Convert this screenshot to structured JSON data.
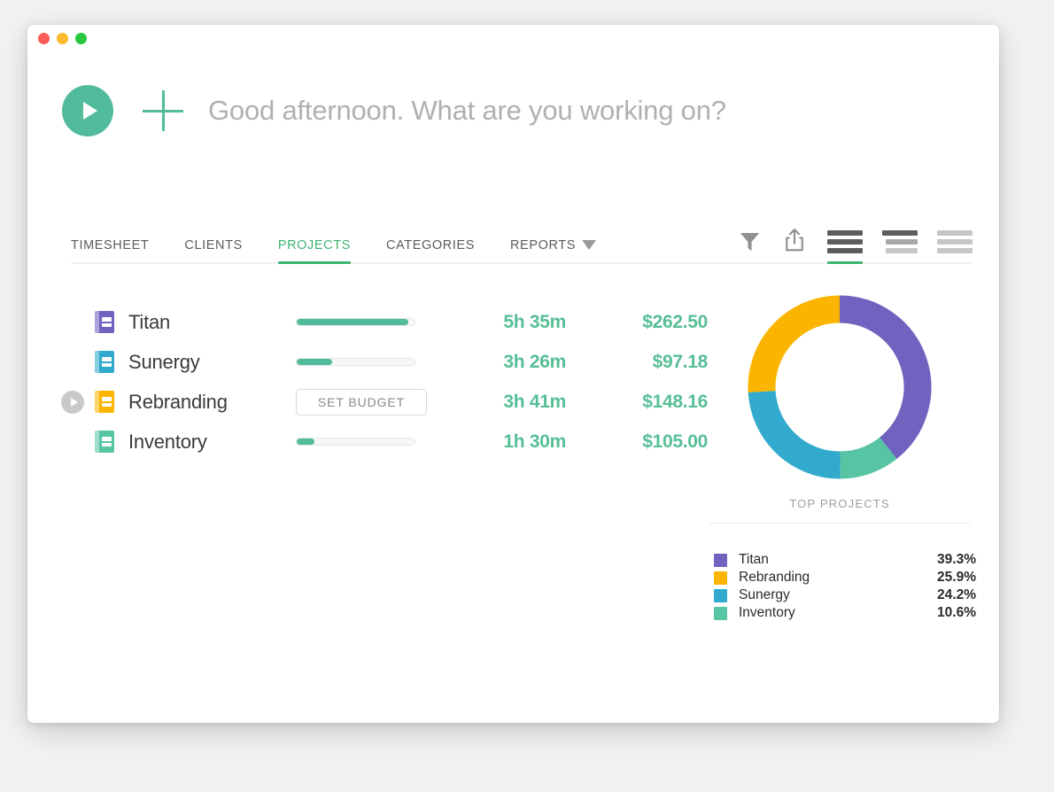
{
  "window": {
    "traffic_lights": [
      {
        "name": "close",
        "color": "#fc5b57"
      },
      {
        "name": "minimize",
        "color": "#fcbb2f"
      },
      {
        "name": "maximize",
        "color": "#28c83f"
      }
    ]
  },
  "header": {
    "play_icon": "play-icon",
    "add_icon": "plus-icon",
    "greeting": "Good afternoon. What are you working on?"
  },
  "tabs": [
    {
      "label": "TIMESHEET",
      "active": false,
      "caret": false
    },
    {
      "label": "CLIENTS",
      "active": false,
      "caret": false
    },
    {
      "label": "PROJECTS",
      "active": true,
      "caret": false
    },
    {
      "label": "CATEGORIES",
      "active": false,
      "caret": false
    },
    {
      "label": "REPORTS",
      "active": false,
      "caret": true
    }
  ],
  "toolbar": [
    {
      "name": "filter-icon",
      "active": false
    },
    {
      "name": "share-icon",
      "active": false
    },
    {
      "name": "view-compact-icon",
      "active": true
    },
    {
      "name": "view-grouped-icon",
      "active": false
    },
    {
      "name": "view-detailed-icon",
      "active": false
    }
  ],
  "projects": [
    {
      "name": "Titan",
      "icon_color": "#6f63bf",
      "budget_type": "progress",
      "progress": 95,
      "budget_label": "",
      "time": "5h 35m",
      "amount": "$262.50",
      "running_toggle": false
    },
    {
      "name": "Sunergy",
      "icon_color": "#31aacd",
      "budget_type": "progress",
      "progress": 30,
      "budget_label": "",
      "time": "3h 26m",
      "amount": "$97.18",
      "running_toggle": false
    },
    {
      "name": "Rebranding",
      "icon_color": "#fbb500",
      "budget_type": "button",
      "progress": 0,
      "budget_label": "SET BUDGET",
      "time": "3h 41m",
      "amount": "$148.16",
      "running_toggle": true
    },
    {
      "name": "Inventory",
      "icon_color": "#57c4a3",
      "budget_type": "progress",
      "progress": 15,
      "budget_label": "",
      "time": "1h 30m",
      "amount": "$105.00",
      "running_toggle": false
    }
  ],
  "chart_data": {
    "type": "pie",
    "title": "TOP PROJECTS",
    "donut": true,
    "start_angle_deg": 0,
    "direction": "clockwise",
    "categories": [
      "Titan",
      "Inventory",
      "Sunergy",
      "Rebranding"
    ],
    "slice_order_clockwise_from_top": [
      "Titan",
      "Inventory",
      "Sunergy",
      "Rebranding"
    ],
    "values": [
      39.3,
      10.6,
      24.2,
      25.9
    ],
    "colors": [
      "#6f63bf",
      "#57c4a3",
      "#31aacd",
      "#fbb500"
    ],
    "legend_position": "bottom",
    "legend": [
      {
        "label": "Titan",
        "value": "39.3%",
        "color": "#6f63bf"
      },
      {
        "label": "Rebranding",
        "value": "25.9%",
        "color": "#fbb500"
      },
      {
        "label": "Sunergy",
        "value": "24.2%",
        "color": "#31aacd"
      },
      {
        "label": "Inventory",
        "value": "10.6%",
        "color": "#57c4a3"
      }
    ]
  },
  "colors": {
    "accent_green": "#51bb9b",
    "tab_green": "#3fb471",
    "value_green": "#56bf96",
    "muted_gray": "#b0b0b0"
  }
}
